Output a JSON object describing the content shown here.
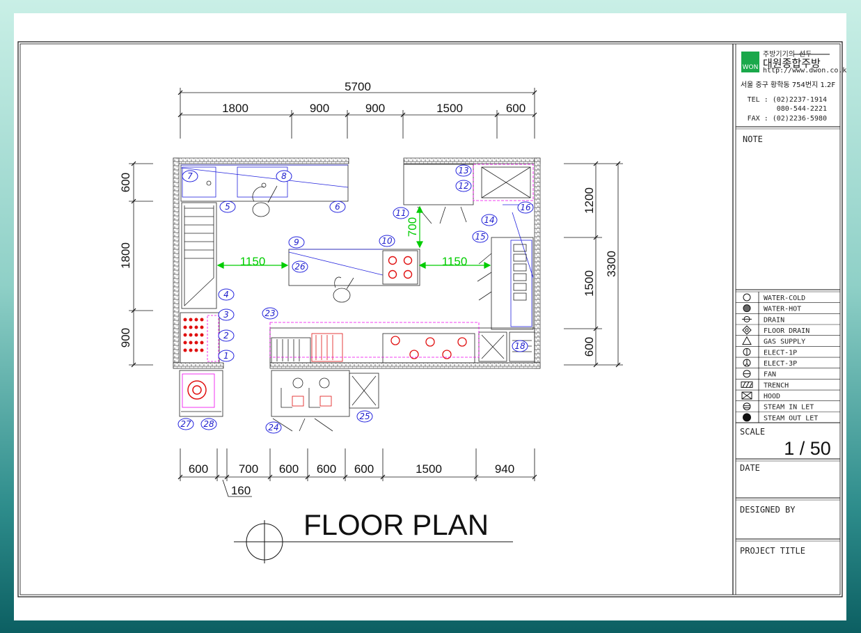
{
  "title": "FLOOR PLAN",
  "company": {
    "logo_mark": "WON",
    "tagline": "주방기기의 선두",
    "name": "대원종합주방",
    "url": "http://www.dwon.co.kr",
    "address": "서울 중구 황학동 754번지 1.2F",
    "tel_1": "TEL : (02)2237-1914",
    "tel_2": "080-544-2221",
    "fax": "FAX : (02)2236-5980"
  },
  "title_block": {
    "note_label": "NOTE",
    "scale_label": "SCALE",
    "scale_value": "1 / 50",
    "date_label": "DATE",
    "designed_by_label": "DESIGNED BY",
    "project_title_label": "PROJECT TITLE"
  },
  "legend": [
    {
      "icon": "water-cold-icon",
      "label": "WATER-COLD"
    },
    {
      "icon": "water-hot-icon",
      "label": "WATER-HOT"
    },
    {
      "icon": "drain-icon",
      "label": "DRAIN"
    },
    {
      "icon": "floor-drain-icon",
      "label": "FLOOR DRAIN"
    },
    {
      "icon": "gas-supply-icon",
      "label": "GAS SUPPLY"
    },
    {
      "icon": "elect-1p-icon",
      "label": "ELECT-1P"
    },
    {
      "icon": "elect-3p-icon",
      "label": "ELECT-3P"
    },
    {
      "icon": "fan-icon",
      "label": "FAN"
    },
    {
      "icon": "trench-icon",
      "label": "TRENCH"
    },
    {
      "icon": "hood-icon",
      "label": "HOOD"
    },
    {
      "icon": "steam-in-let-icon",
      "label": "STEAM IN LET"
    },
    {
      "icon": "steam-out-let-icon",
      "label": "STEAM OUT LET"
    }
  ],
  "dimensions": {
    "top_total": "5700",
    "top": [
      "1800",
      "900",
      "900",
      "1500",
      "600"
    ],
    "bottom": [
      "600",
      "700",
      "600",
      "600",
      "600",
      "1500",
      "940"
    ],
    "bottom_extra": "160",
    "left": [
      "600",
      "1800",
      "900"
    ],
    "right": [
      "1200",
      "1500",
      "600"
    ],
    "right_total": "3300",
    "aisle_left": "1150",
    "aisle_right": "1150",
    "aisle_vertical": "700"
  },
  "equipment_numbers": [
    "1",
    "2",
    "3",
    "4",
    "5",
    "6",
    "7",
    "8",
    "9",
    "10",
    "11",
    "12",
    "13",
    "14",
    "15",
    "16",
    "18",
    "23",
    "24",
    "25",
    "26",
    "27",
    "28"
  ],
  "colors": {
    "wall": "#3a3a3a",
    "blue_line": "#2222dd",
    "magenta_line": "#ee00ee",
    "dimension_green": "#00cc00",
    "burner_red": "#e01010",
    "border": "#111111"
  }
}
